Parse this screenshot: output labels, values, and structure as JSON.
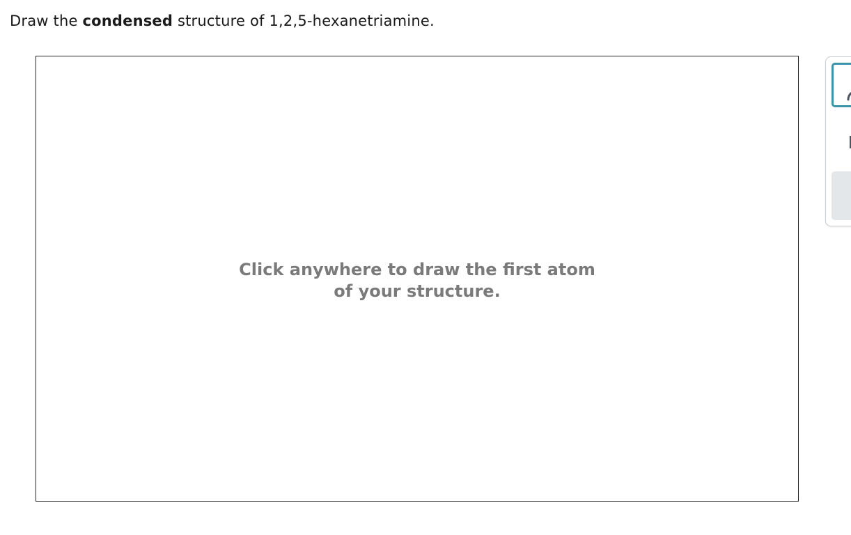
{
  "question": {
    "prefix": "Draw the ",
    "emphasis": "condensed",
    "suffix": " structure of 1,2,5-hexanetriamine."
  },
  "canvas": {
    "hint_line1": "Click anywhere to draw the first atom",
    "hint_line2": "of your structure."
  },
  "toolbar": {
    "accent_color": "#3d93a8",
    "tools": [
      {
        "name": "draw-tool",
        "icon": "pencil-icon",
        "selected": true
      },
      {
        "name": "select-tool",
        "icon": "selection-box-icon",
        "selected": false
      },
      {
        "name": "erase-tool",
        "icon": "eraser-icon",
        "selected": false
      }
    ]
  }
}
